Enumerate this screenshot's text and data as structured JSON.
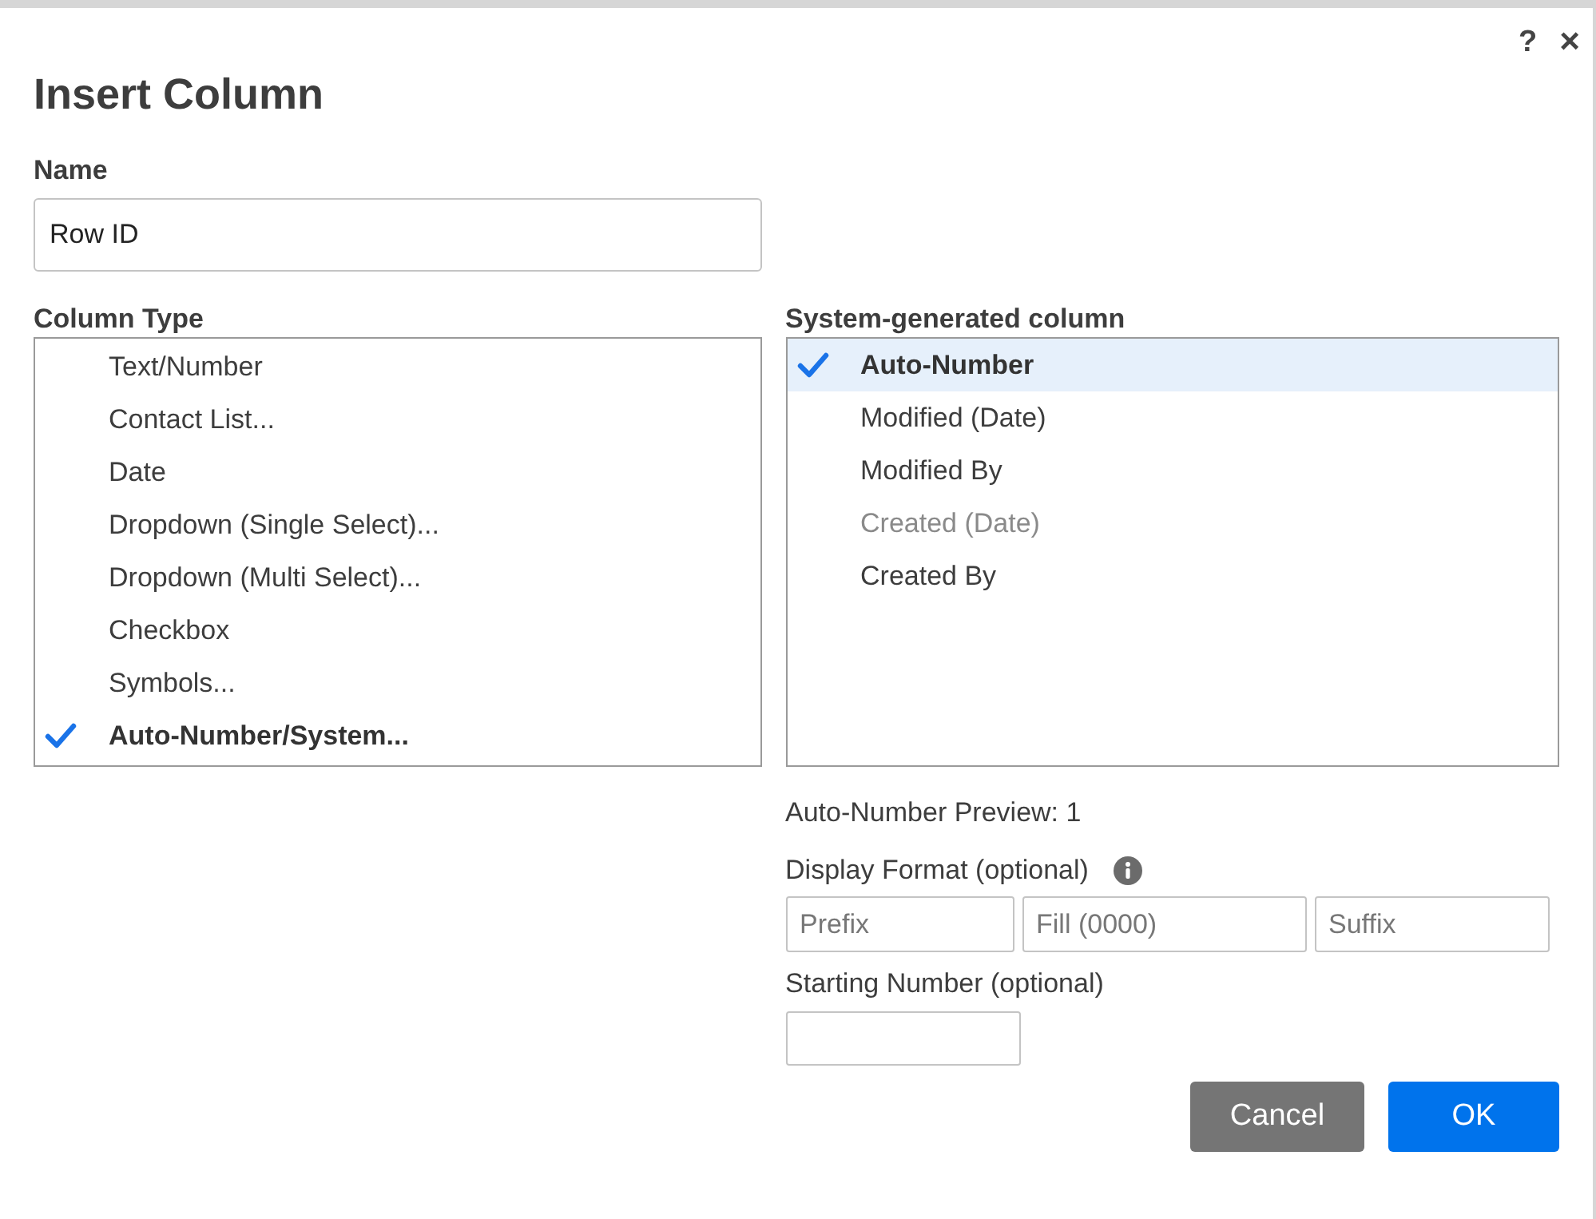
{
  "dialog": {
    "title": "Insert Column",
    "help": "?",
    "close": "×"
  },
  "name_field": {
    "label": "Name",
    "value": "Row ID"
  },
  "column_type": {
    "label": "Column Type",
    "items": [
      {
        "label": "Text/Number",
        "selected": false
      },
      {
        "label": "Contact List...",
        "selected": false
      },
      {
        "label": "Date",
        "selected": false
      },
      {
        "label": "Dropdown (Single Select)...",
        "selected": false
      },
      {
        "label": "Dropdown (Multi Select)...",
        "selected": false
      },
      {
        "label": "Checkbox",
        "selected": false
      },
      {
        "label": "Symbols...",
        "selected": false
      },
      {
        "label": "Auto-Number/System...",
        "selected": true
      }
    ]
  },
  "system_column": {
    "label": "System-generated column",
    "items": [
      {
        "label": "Auto-Number",
        "selected": true,
        "disabled": false
      },
      {
        "label": "Modified (Date)",
        "selected": false,
        "disabled": false
      },
      {
        "label": "Modified By",
        "selected": false,
        "disabled": false
      },
      {
        "label": "Created (Date)",
        "selected": false,
        "disabled": true
      },
      {
        "label": "Created By",
        "selected": false,
        "disabled": false
      }
    ]
  },
  "preview": "Auto-Number Preview: 1",
  "display_format": {
    "label": "Display Format (optional)",
    "fields": [
      {
        "placeholder": "Prefix"
      },
      {
        "placeholder": "Fill (0000)"
      },
      {
        "placeholder": "Suffix"
      }
    ]
  },
  "starting_number": {
    "label": "Starting Number (optional)"
  },
  "buttons": [
    {
      "label": "Cancel",
      "kind": "secondary"
    },
    {
      "label": "OK",
      "kind": "primary"
    }
  ]
}
